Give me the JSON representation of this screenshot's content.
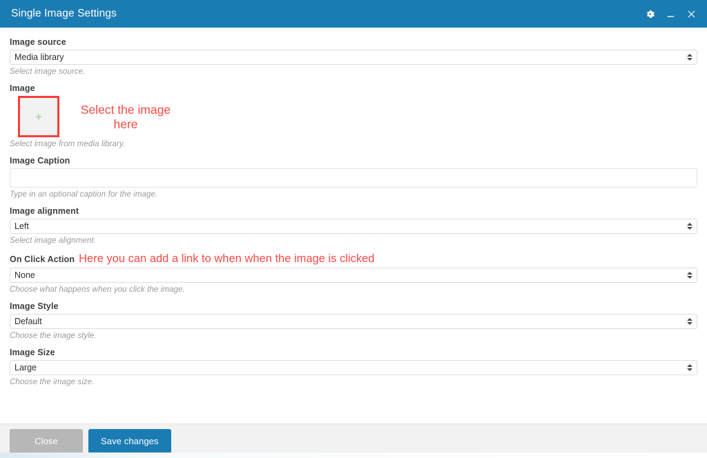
{
  "window": {
    "title": "Single Image Settings",
    "controls": [
      {
        "name": "settings-gear",
        "icon": "gear-icon"
      },
      {
        "name": "minimize",
        "icon": "minimize-icon"
      },
      {
        "name": "close",
        "icon": "close-icon"
      }
    ]
  },
  "form": {
    "image_source": {
      "label": "Image source",
      "value": "Media library",
      "options": [
        "Media library"
      ],
      "help": "Select image source."
    },
    "image": {
      "label": "Image",
      "placeholder_glyph": "+",
      "help": "Select image from media library.",
      "annotation": "Select the image here"
    },
    "image_caption": {
      "label": "Image Caption",
      "value": "",
      "placeholder": "",
      "help": "Type in an optional caption for the image."
    },
    "image_alignment": {
      "label": "Image alignment",
      "value": "Left",
      "options": [
        "Left"
      ],
      "help": "Select image alignment."
    },
    "on_click_action": {
      "label": "On Click Action",
      "value": "None",
      "options": [
        "None"
      ],
      "help": "Choose what happens when you click the image.",
      "annotation": "Here you can add a link to when when the image is clicked"
    },
    "image_style": {
      "label": "Image Style",
      "value": "Default",
      "options": [
        "Default"
      ],
      "help": "Choose the image style."
    },
    "image_size": {
      "label": "Image Size",
      "value": "Large",
      "options": [
        "Large"
      ],
      "help": "Choose the image size."
    }
  },
  "footer": {
    "close_label": "Close",
    "save_label": "Save changes"
  },
  "colors": {
    "header_blue": "#1b7cb3",
    "primary_button": "#1b7cb3",
    "secondary_button": "#b7b7b7",
    "annotation_red": "#fc4a45",
    "picker_border_red": "#fc3d39",
    "plus_green": "#8ed07b"
  }
}
